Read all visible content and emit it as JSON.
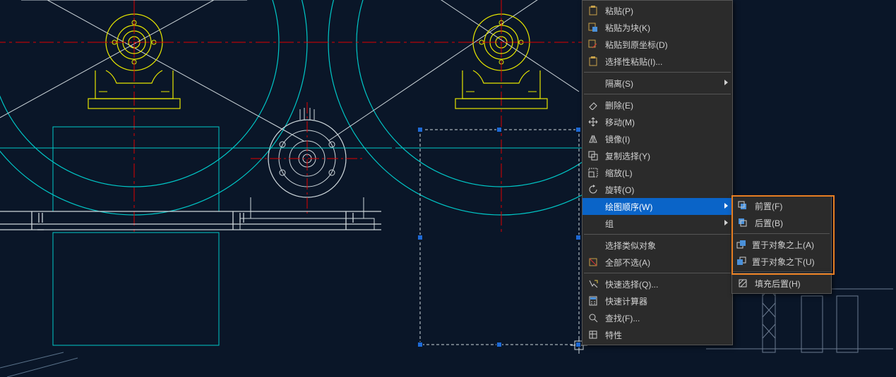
{
  "menu": {
    "paste": "粘贴(P)",
    "paste_block": "粘贴为块(K)",
    "paste_orig": "粘贴到原坐标(D)",
    "paste_special": "选择性粘贴(I)...",
    "isolate": "隔离(S)",
    "erase": "删除(E)",
    "move": "移动(M)",
    "mirror": "镜像(I)",
    "copy_sel": "复制选择(Y)",
    "scale": "缩放(L)",
    "rotate": "旋转(O)",
    "draworder": "绘图顺序(W)",
    "group": "组",
    "select_similar": "选择类似对象",
    "deselect_all": "全部不选(A)",
    "qselect": "快速选择(Q)...",
    "quickcalc": "快速计算器",
    "find": "查找(F)...",
    "properties": "特性"
  },
  "sub": {
    "front": "前置(F)",
    "back": "后置(B)",
    "above": "置于对象之上(A)",
    "below": "置于对象之下(U)",
    "hatchback": "填充后置(H)"
  }
}
